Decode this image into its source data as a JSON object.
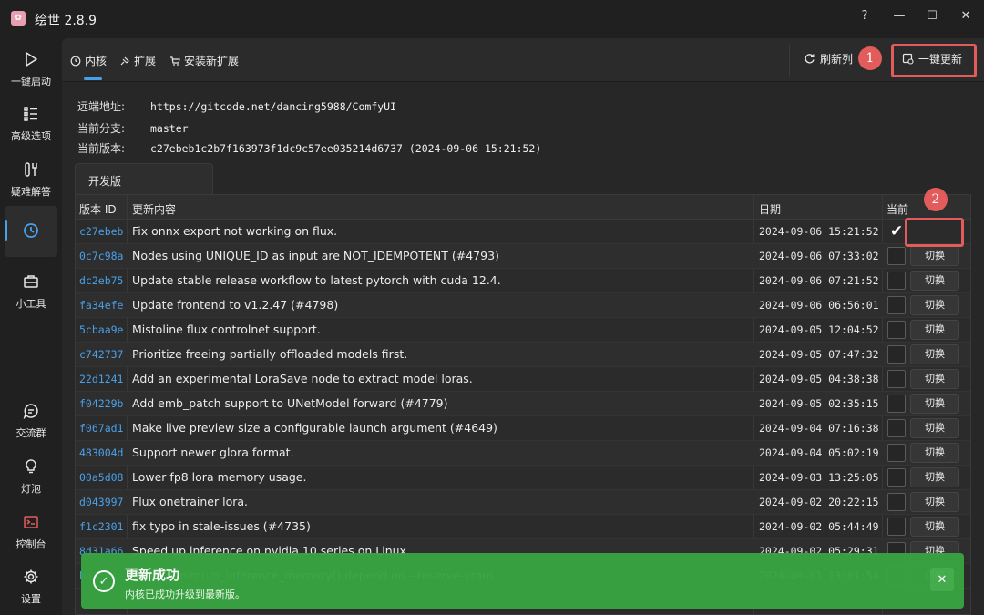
{
  "window": {
    "title": "绘世 2.8.9",
    "help": "?",
    "minimize": "—",
    "maximize": "☐",
    "close": "✕"
  },
  "sidebar": {
    "items": [
      {
        "label": "一键启动",
        "icon": "play-icon"
      },
      {
        "label": "高级选项",
        "icon": "list-icon"
      },
      {
        "label": "疑难解答",
        "icon": "tools-icon"
      },
      {
        "label": "",
        "icon": "history-icon",
        "active": true
      },
      {
        "label": "小工具",
        "icon": "toolbox-icon"
      },
      {
        "label": "交流群",
        "icon": "chat-icon"
      },
      {
        "label": "灯泡",
        "icon": "bulb-icon"
      },
      {
        "label": "控制台",
        "icon": "console-icon"
      },
      {
        "label": "设置",
        "icon": "gear-icon"
      }
    ]
  },
  "toolbar": {
    "tabs": [
      {
        "label": "内核",
        "icon": "history-icon"
      },
      {
        "label": "扩展",
        "icon": "puzzle-icon"
      },
      {
        "label": "安装新扩展",
        "icon": "cart-icon"
      }
    ],
    "refresh_label": "刷新列",
    "update_all_label": "一键更新"
  },
  "info": {
    "remote_key": "远端地址:",
    "remote_value": "https://gitcode.net/dancing5988/ComfyUI",
    "branch_key": "当前分支:",
    "branch_value": "master",
    "version_key": "当前版本:",
    "version_value": "c27ebeb1c2b7f163973f1dc9c57ee035214d6737 (2024-09-06 15:21:52)"
  },
  "branch_tab": "开发版",
  "table": {
    "headers": {
      "id": "版本 ID",
      "content": "更新内容",
      "date": "日期",
      "current": "当前"
    },
    "switch_label": "切换",
    "rows": [
      {
        "id": "c27ebeb",
        "msg": "Fix onnx export not working on flux.",
        "date": "2024-09-06 15:21:52",
        "current": true
      },
      {
        "id": "0c7c98a",
        "msg": "Nodes using UNIQUE_ID as input are NOT_IDEMPOTENT (#4793)",
        "date": "2024-09-06 07:33:02",
        "current": false
      },
      {
        "id": "dc2eb75",
        "msg": "Update stable release workflow to latest pytorch with cuda 12.4.",
        "date": "2024-09-06 07:21:52",
        "current": false
      },
      {
        "id": "fa34efe",
        "msg": "Update frontend to v1.2.47 (#4798)",
        "date": "2024-09-06 06:56:01",
        "current": false
      },
      {
        "id": "5cbaa9e",
        "msg": "Mistoline flux controlnet support.",
        "date": "2024-09-05 12:04:52",
        "current": false
      },
      {
        "id": "c742737",
        "msg": "Prioritize freeing partially offloaded models first.",
        "date": "2024-09-05 07:47:32",
        "current": false
      },
      {
        "id": "22d1241",
        "msg": "Add an experimental LoraSave node to extract model loras.",
        "date": "2024-09-05 04:38:38",
        "current": false
      },
      {
        "id": "f04229b",
        "msg": "Add emb_patch support to UNetModel forward (#4779)",
        "date": "2024-09-05 02:35:15",
        "current": false
      },
      {
        "id": "f067ad1",
        "msg": "Make live preview size a configurable launch argument (#4649)",
        "date": "2024-09-04 07:16:38",
        "current": false
      },
      {
        "id": "483004d",
        "msg": "Support newer glora format.",
        "date": "2024-09-04 05:02:19",
        "current": false
      },
      {
        "id": "00a5d08",
        "msg": "Lower fp8 lora memory usage.",
        "date": "2024-09-03 13:25:05",
        "current": false
      },
      {
        "id": "d043997",
        "msg": "Flux onetrainer lora.",
        "date": "2024-09-02 20:22:15",
        "current": false
      },
      {
        "id": "f1c2301",
        "msg": "fix typo in stale-issues (#4735)",
        "date": "2024-09-02 05:44:49",
        "current": false
      },
      {
        "id": "8d31a66",
        "msg": "Speed up inference on nvidia 10 series on Linux.",
        "date": "2024-09-02 05:29:31",
        "current": false
      },
      {
        "id": "b643eae",
        "msg": "Make minimum_inference_memory() depend on --reserve-vram",
        "date": "2024-09-01 13:01:54",
        "current": false
      }
    ]
  },
  "markers": {
    "one": "1",
    "two": "2"
  },
  "toast": {
    "title": "更新成功",
    "message": "内核已成功升级到最新版。",
    "close": "✕"
  },
  "colors": {
    "accent": "#4aa0e8",
    "marker": "#e25c5c",
    "success": "#39a342"
  }
}
